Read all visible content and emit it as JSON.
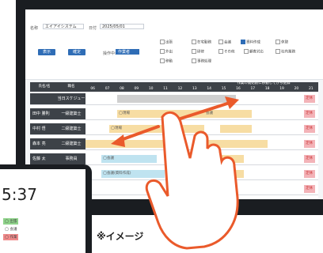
{
  "app": {
    "field1_label": "名称",
    "field1_value": "エイアイシステム",
    "field2_label": "日付",
    "field2_value": "2025/05/01",
    "btn_display": "表示",
    "btn_confirm": "確定",
    "status_label": "操作中:",
    "status_value": "作業者"
  },
  "legend": [
    "出張",
    "在宅勤務",
    "会議",
    "資料作成",
    "休憩",
    "外出",
    "研修",
    "その他",
    "顧客対応",
    "社内業務",
    "移動",
    "事務処理"
  ],
  "grid": {
    "header_title": "作業の開始前に移動してから記録",
    "col_name": "氏名/名",
    "col_role": "職名",
    "hours": [
      "06",
      "07",
      "08",
      "09",
      "10",
      "11",
      "12",
      "13",
      "14",
      "15",
      "16",
      "17",
      "18",
      "19",
      "20",
      "21"
    ],
    "rows": [
      {
        "name": "",
        "role": "当日スケジュール",
        "bars": [
          {
            "label": ""
          }
        ]
      },
      {
        "name": "田中 勝則",
        "role": "一級建築士",
        "bars": [
          {
            "label": "◯現場"
          },
          {
            "label": "会議"
          }
        ]
      },
      {
        "name": "中村 悟",
        "role": "二級建築士",
        "bars": [
          {
            "label": "◯現場"
          },
          {
            "label": ""
          }
        ]
      },
      {
        "name": "森本 亮",
        "role": "二級建築士",
        "bars": [
          {
            "label": ""
          },
          {
            "label": ""
          }
        ]
      },
      {
        "name": "佐藤 太",
        "role": "事務員",
        "bars": [
          {
            "label": "◯会議"
          },
          {
            "label": ""
          }
        ]
      },
      {
        "name": "井坂 理",
        "role": "事務員",
        "bars": [
          {
            "label": "◯会議(資料作成)"
          },
          {
            "label": ""
          }
        ]
      },
      {
        "name": "",
        "role": "",
        "bars": []
      }
    ],
    "side_label": "定休"
  },
  "phone": {
    "time": "5:37",
    "list": [
      "◯ 出張",
      "◯ 会議",
      "◯ 作業"
    ]
  },
  "caption": "※イメージ"
}
